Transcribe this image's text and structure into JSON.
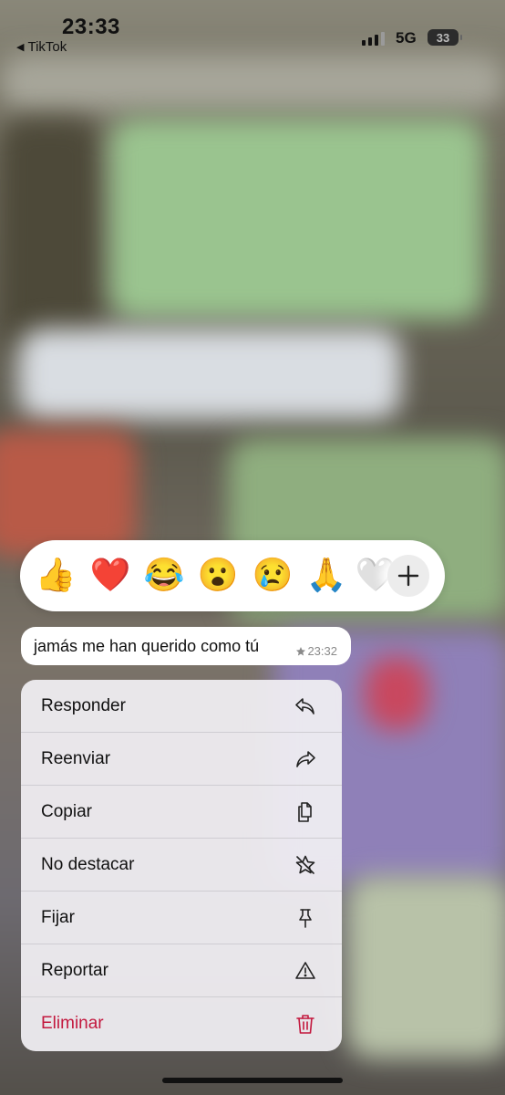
{
  "status_bar": {
    "time": "23:33",
    "back_app": "TikTok",
    "network": "5G",
    "battery": "33"
  },
  "reactions": {
    "emojis": [
      "👍",
      "❤️",
      "😂",
      "😮",
      "😢",
      "🙏",
      "🤍"
    ],
    "more_icon": "plus-icon"
  },
  "message": {
    "text": "jamás me han querido como tú",
    "starred_icon": "star-icon",
    "time": "23:32"
  },
  "menu": {
    "items": [
      {
        "label": "Responder",
        "icon": "reply-icon"
      },
      {
        "label": "Reenviar",
        "icon": "forward-icon"
      },
      {
        "label": "Copiar",
        "icon": "copy-icon"
      },
      {
        "label": "No destacar",
        "icon": "unstar-icon"
      },
      {
        "label": "Fijar",
        "icon": "pin-icon"
      },
      {
        "label": "Reportar",
        "icon": "warning-icon"
      },
      {
        "label": "Eliminar",
        "icon": "trash-icon"
      }
    ],
    "danger_color": "#c3183e"
  }
}
